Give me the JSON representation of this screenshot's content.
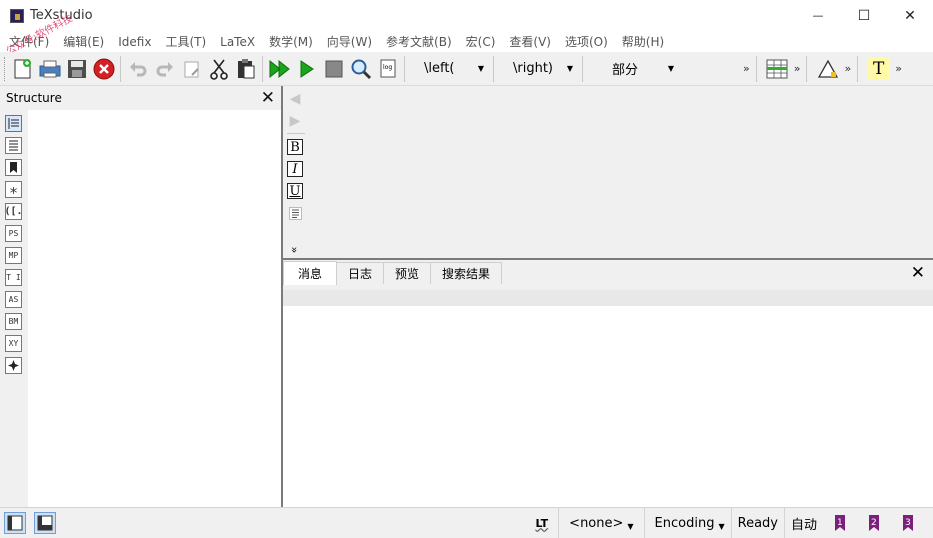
{
  "window": {
    "title": "TeXstudio",
    "controls": {
      "minimize": "—",
      "maximize": "☐",
      "close": "✕"
    }
  },
  "watermark": "公众号:软件科技",
  "menu": [
    "文件(F)",
    "编辑(E)",
    "Idefix",
    "工具(T)",
    "LaTeX",
    "数学(M)",
    "向导(W)",
    "参考文献(B)",
    "宏(C)",
    "查看(V)",
    "选项(O)",
    "帮助(H)"
  ],
  "toolbar": {
    "left_combo": "\\left(",
    "right_combo": "\\right)",
    "section_combo": "部分",
    "more": "»",
    "highlight_glyph": "T"
  },
  "structure": {
    "title": "Structure",
    "close": "✕",
    "icons": [
      "",
      "",
      "",
      "∗",
      "([.",
      "PS",
      "MP",
      "T I",
      "AS",
      "BM",
      "XY",
      ""
    ]
  },
  "editor": {
    "format_buttons": {
      "bold": "B",
      "italic": "I",
      "underline": "U",
      "expand": "»"
    }
  },
  "messages": {
    "tabs": [
      "消息",
      "日志",
      "预览",
      "搜索结果"
    ],
    "active_tab": "消息",
    "close": "✕"
  },
  "status": {
    "lt": "LT",
    "language": "<none>",
    "encoding": "Encoding",
    "ready": "Ready",
    "auto": "自动",
    "bookmarks": [
      "1",
      "2",
      "3"
    ],
    "bookmark_color": "#7a1f7a"
  }
}
